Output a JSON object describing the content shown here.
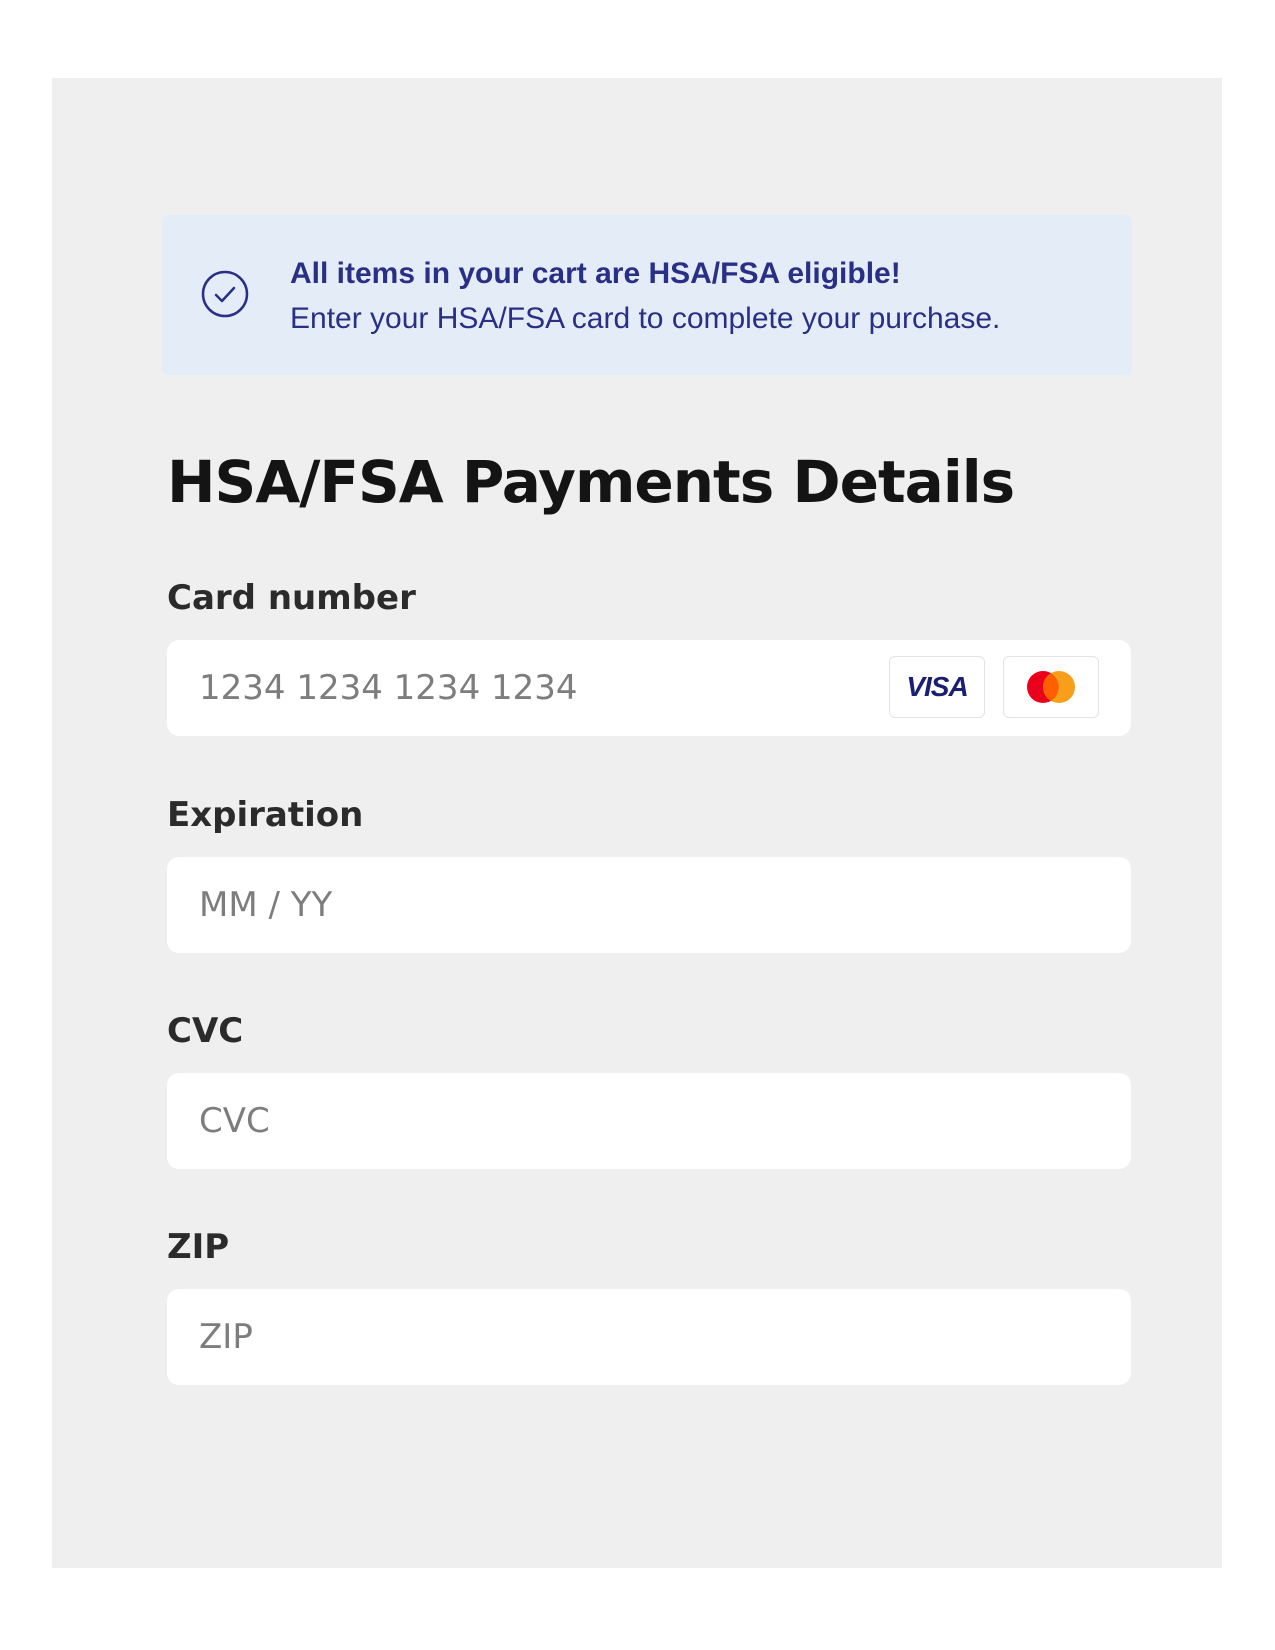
{
  "banner": {
    "title": "All items in your cart are HSA/FSA eligible!",
    "subtitle": "Enter your HSA/FSA card to complete your purchase.",
    "icon": "check-circle-icon"
  },
  "heading": "HSA/FSA Payments Details",
  "fields": {
    "card_number": {
      "label": "Card number",
      "placeholder": "1234 1234 1234 1234",
      "brands": [
        {
          "name": "VISA",
          "icon": "visa-logo"
        },
        {
          "name": "Mastercard",
          "icon": "mastercard-logo"
        }
      ]
    },
    "expiration": {
      "label": "Expiration",
      "placeholder": "MM / YY"
    },
    "cvc": {
      "label": "CVC",
      "placeholder": "CVC"
    },
    "zip": {
      "label": "ZIP",
      "placeholder": "ZIP"
    }
  },
  "colors": {
    "panel_background": "#efeff0",
    "banner_background": "#e4edf7",
    "banner_text": "#2a2f86",
    "visa_blue": "#1a1f71",
    "mastercard_red": "#eb001b",
    "mastercard_orange": "#f79e1b"
  }
}
